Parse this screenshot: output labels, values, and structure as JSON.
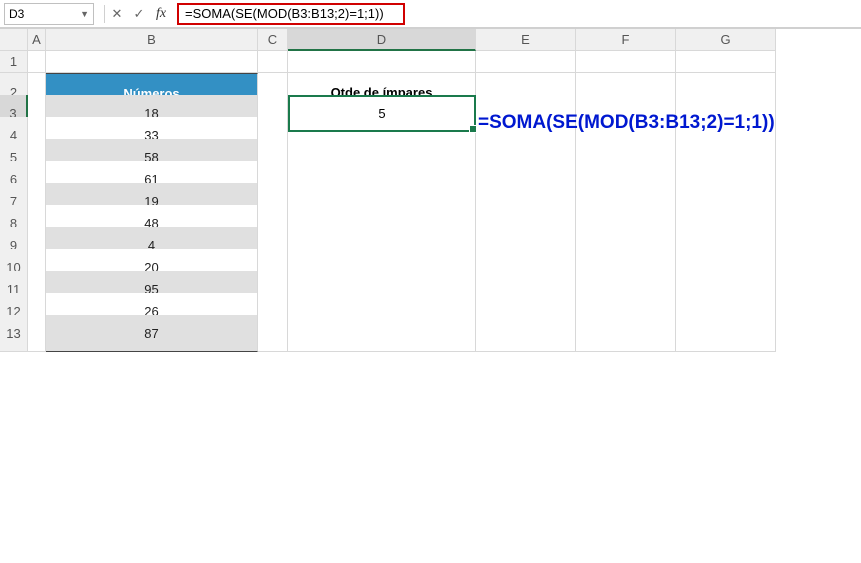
{
  "formula_bar": {
    "name_box": "D3",
    "formula": "=SOMA(SE(MOD(B3:B13;2)=1;1))"
  },
  "columns": [
    "A",
    "B",
    "C",
    "D",
    "E",
    "F",
    "G"
  ],
  "rows": [
    "1",
    "2",
    "3",
    "4",
    "5",
    "6",
    "7",
    "8",
    "9",
    "10",
    "11",
    "12",
    "13"
  ],
  "table": {
    "header": "Números",
    "values": [
      "18",
      "33",
      "58",
      "61",
      "19",
      "48",
      "4",
      "20",
      "95",
      "26",
      "87"
    ]
  },
  "result": {
    "header": "Qtde de ímpares",
    "value": "5"
  },
  "annotation": "=SOMA(SE(MOD(B3:B13;2)=1;1))",
  "active_column": "D",
  "active_row": "3",
  "chart_data": {
    "type": "table",
    "title": "Números",
    "values": [
      18,
      33,
      58,
      61,
      19,
      48,
      4,
      20,
      95,
      26,
      87
    ],
    "derived": {
      "label": "Qtde de ímpares",
      "value": 5,
      "formula": "=SOMA(SE(MOD(B3:B13;2)=1;1))"
    }
  }
}
